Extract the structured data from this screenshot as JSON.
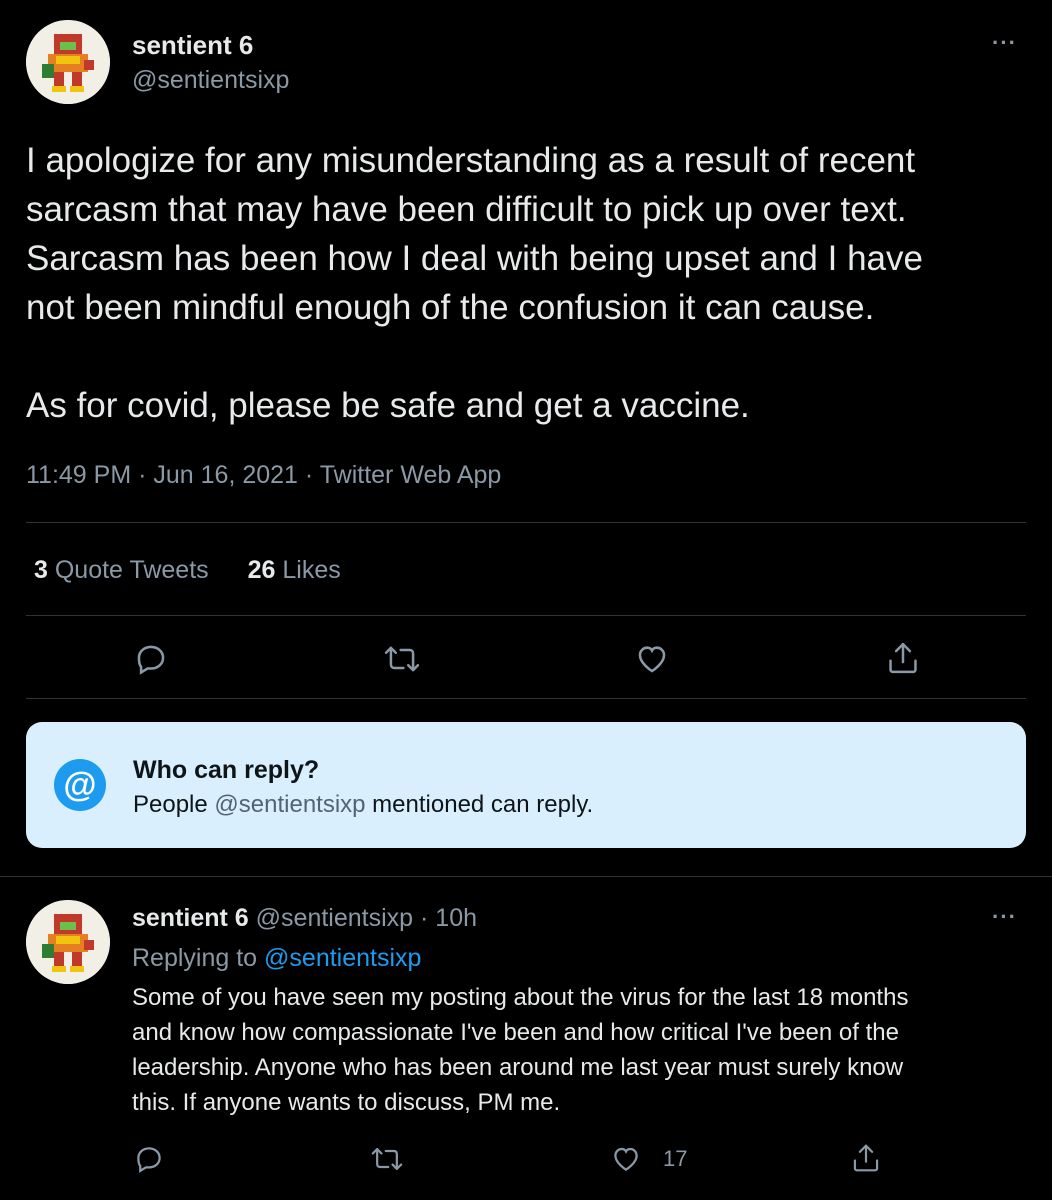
{
  "main_tweet": {
    "author_name": "sentient 6",
    "author_handle": "@sentientsixp",
    "more_label": "···",
    "text": "I apologize for any misunderstanding as a result of recent\nsarcasm that may have been difficult to pick up over text.\nSarcasm has been how I deal with being upset and I have\nnot been mindful enough of the confusion it can cause.\n\nAs for covid, please be safe and get a vaccine.",
    "time": "11:49 PM",
    "date": "Jun 16, 2021",
    "source": "Twitter Web App",
    "separator": "·",
    "quote_count": "3",
    "quote_label": "Quote Tweets",
    "like_count": "26",
    "like_label": "Likes"
  },
  "actions": {
    "icons": [
      "reply-icon",
      "retweet-icon",
      "like-icon",
      "share-icon"
    ]
  },
  "reply_restriction": {
    "icon_symbol": "@",
    "title": "Who can reply?",
    "body_prefix": "People ",
    "body_handle": "@sentientsixp",
    "body_suffix": " mentioned can reply."
  },
  "reply_tweet": {
    "author_name": "sentient 6",
    "author_handle": "@sentientsixp",
    "separator": "·",
    "age": "10h",
    "more_label": "···",
    "replying_prefix": "Replying to ",
    "replying_handle": "@sentientsixp",
    "text": "Some of you have seen my posting about the virus for the last 18 months\nand know how compassionate I've been and how critical I've been of the\nleadership. Anyone who has been around me last year must surely know\nthis. If anyone wants to discuss, PM me.",
    "like_count": "17"
  },
  "colors": {
    "background": "#000000",
    "text_primary": "#e7e9ea",
    "text_secondary": "#8b98a5",
    "accent": "#1d9bf0",
    "reply_box_bg": "#d9effd",
    "divider": "#2f3336"
  }
}
